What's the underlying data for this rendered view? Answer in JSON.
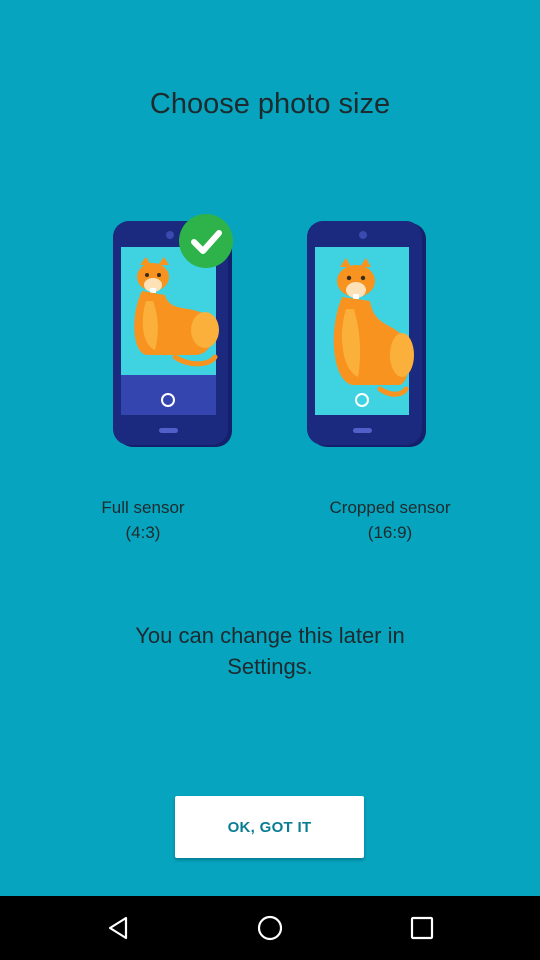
{
  "header": {
    "title": "Choose photo size"
  },
  "options": [
    {
      "label_line1": "Full sensor",
      "label_line2": "(4:3)",
      "selected": true
    },
    {
      "label_line1": "Cropped sensor",
      "label_line2": "(16:9)",
      "selected": false
    }
  ],
  "info_text": "You can change this later in Settings.",
  "ok_button": {
    "label": "OK, GOT IT"
  },
  "navbar": {
    "icons": [
      "back-icon",
      "home-icon",
      "recent-apps-icon"
    ]
  },
  "colors": {
    "background": "#06a4be",
    "phone_body": "#1b2a7e",
    "screen": "#3fd3e1",
    "fox": "#f7931e",
    "check_badge": "#2db34a",
    "button_text": "#0a7d93"
  }
}
